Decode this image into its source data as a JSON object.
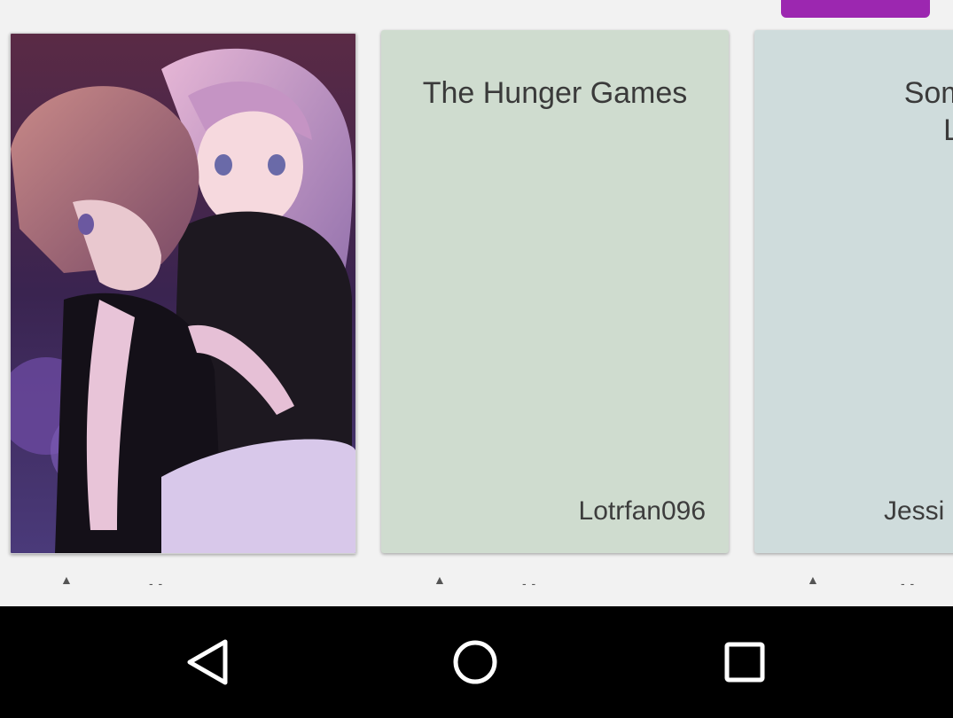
{
  "top_bar": {
    "action_button_color": "#9c27b0"
  },
  "stories": [
    {
      "cover": "anime-couple-cover-image",
      "title": "",
      "author": ""
    },
    {
      "title": "The Hunger Games",
      "author": "Lotrfan096",
      "cover_color": "#cfdccf"
    },
    {
      "title": "Something\nLove",
      "author": "Jessi",
      "cover_color": "#cfdcdc"
    }
  ],
  "meta_icons": [
    "up-arrow-icon",
    "comment-icon"
  ],
  "nav": {
    "back_icon": "back-triangle-icon",
    "home_icon": "home-circle-icon",
    "recents_icon": "recents-square-icon"
  }
}
